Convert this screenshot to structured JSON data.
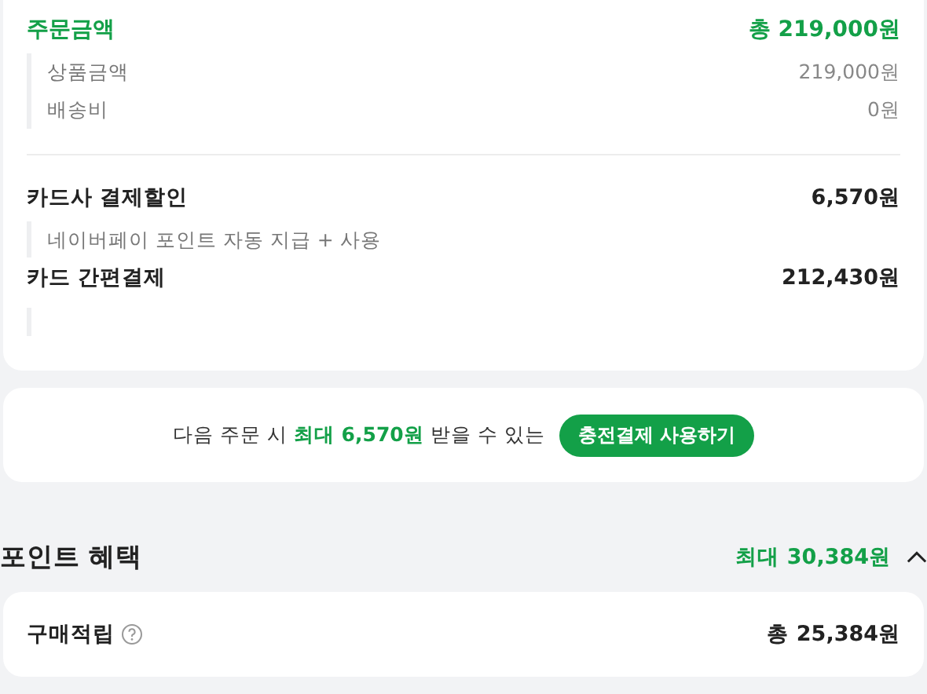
{
  "order_summary": {
    "title": "주문금액",
    "total": "총 219,000원",
    "breakdown": [
      {
        "label": "상품금액",
        "value": "219,000원"
      },
      {
        "label": "배송비",
        "value": "0원"
      }
    ],
    "discount": {
      "label": "카드사 결제할인",
      "value": "6,570원",
      "note": "네이버페이 포인트 자동 지급 + 사용"
    },
    "payment": {
      "label": "카드 간편결제",
      "value": "212,430원"
    }
  },
  "promo": {
    "text": "다음 주문 시 **최대 6,570원** 받을 수 있는",
    "button": "충전결제 사용하기"
  },
  "points": {
    "title": "포인트 혜택",
    "max": "최대 30,384원",
    "expanded": true,
    "items": [
      {
        "label": "구매적립",
        "value": "총 25,384원",
        "help": true
      }
    ]
  }
}
